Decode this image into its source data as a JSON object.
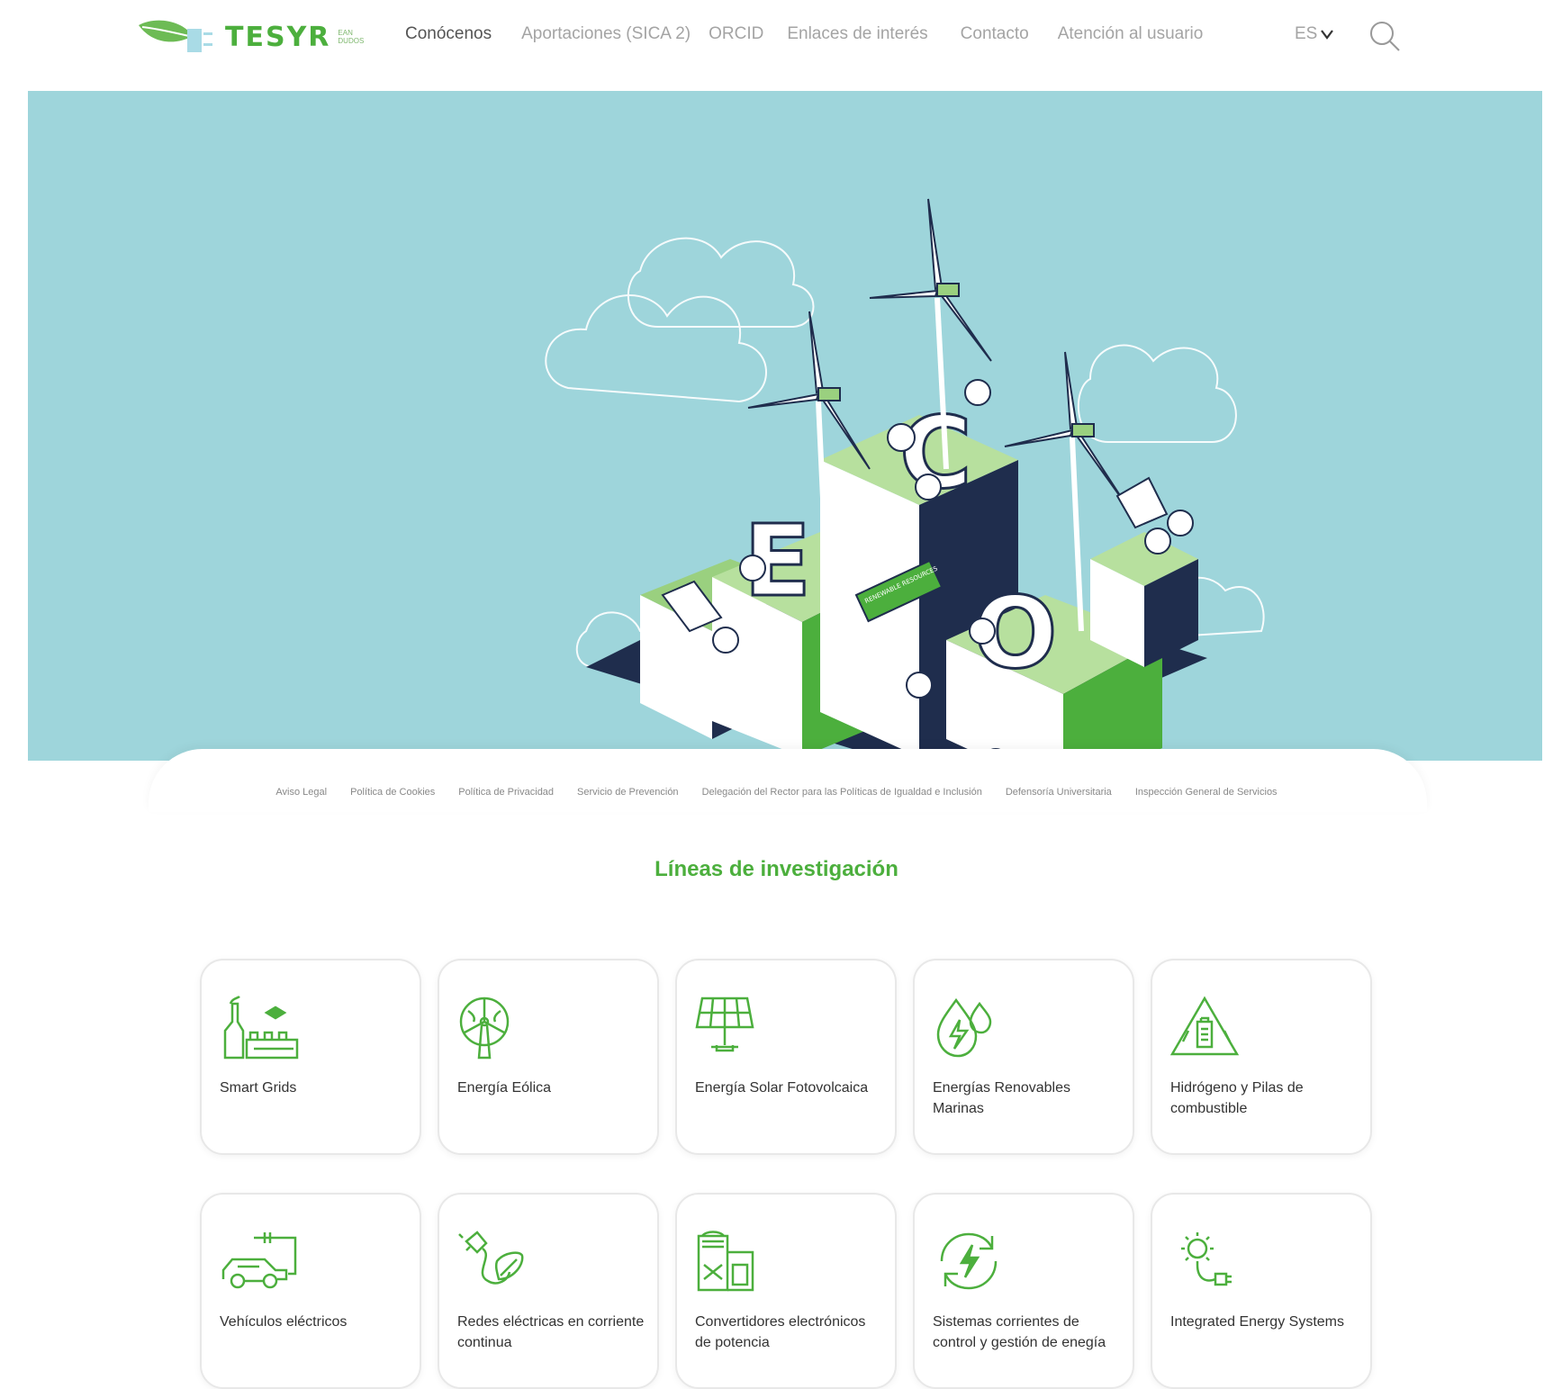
{
  "header": {
    "logo_text": "TESYR",
    "logo_subtext": "EAN\nDUDOS",
    "nav": [
      {
        "label": "Conócenos",
        "active": true
      },
      {
        "label": "Aportaciones (SICA 2)",
        "active": false
      },
      {
        "label": "ORCID",
        "active": false
      },
      {
        "label": "Enlaces de interés",
        "active": false
      },
      {
        "label": "Contacto",
        "active": false
      },
      {
        "label": "Atención al usuario",
        "active": false
      }
    ],
    "lang": "ES",
    "search_icon": "search-icon"
  },
  "hero": {
    "letters": [
      "E",
      "C",
      "O"
    ],
    "sign_text": "RENEWABLE RESOURCES"
  },
  "legal_links": [
    "Aviso Legal",
    "Política de Cookies",
    "Política de Privacidad",
    "Servicio de Prevención",
    "Delegación del Rector para las Políticas de Igualdad e Inclusión",
    "Defensoría Universitaria",
    "Inspección General de Servicios"
  ],
  "research": {
    "title": "Líneas de investigación",
    "cards": [
      {
        "label": "Smart Grids",
        "icon": "smart-grid-icon"
      },
      {
        "label": "Energía Eólica",
        "icon": "wind-turbine-icon"
      },
      {
        "label": "Energía Solar Fotovolcaica",
        "icon": "solar-panel-icon"
      },
      {
        "label": "Energías Renovables Marinas",
        "icon": "water-energy-icon"
      },
      {
        "label": "Hidrógeno y Pilas de combustible",
        "icon": "hydrogen-icon"
      },
      {
        "label": "Vehículos eléctricos",
        "icon": "electric-car-icon"
      },
      {
        "label": "Redes eléctricas en corriente continua",
        "icon": "plug-leaf-icon"
      },
      {
        "label": "Convertidores electrónicos de potencia",
        "icon": "power-converter-icon"
      },
      {
        "label": "Sistemas corrientes de control y gestión de enegía",
        "icon": "energy-cycle-icon"
      },
      {
        "label": "Integrated Energy Systems",
        "icon": "sun-plug-icon"
      }
    ]
  },
  "colors": {
    "brand_green": "#4caf3d",
    "hero_bg": "#9ed5db",
    "nav_text": "#a4a4a4"
  }
}
